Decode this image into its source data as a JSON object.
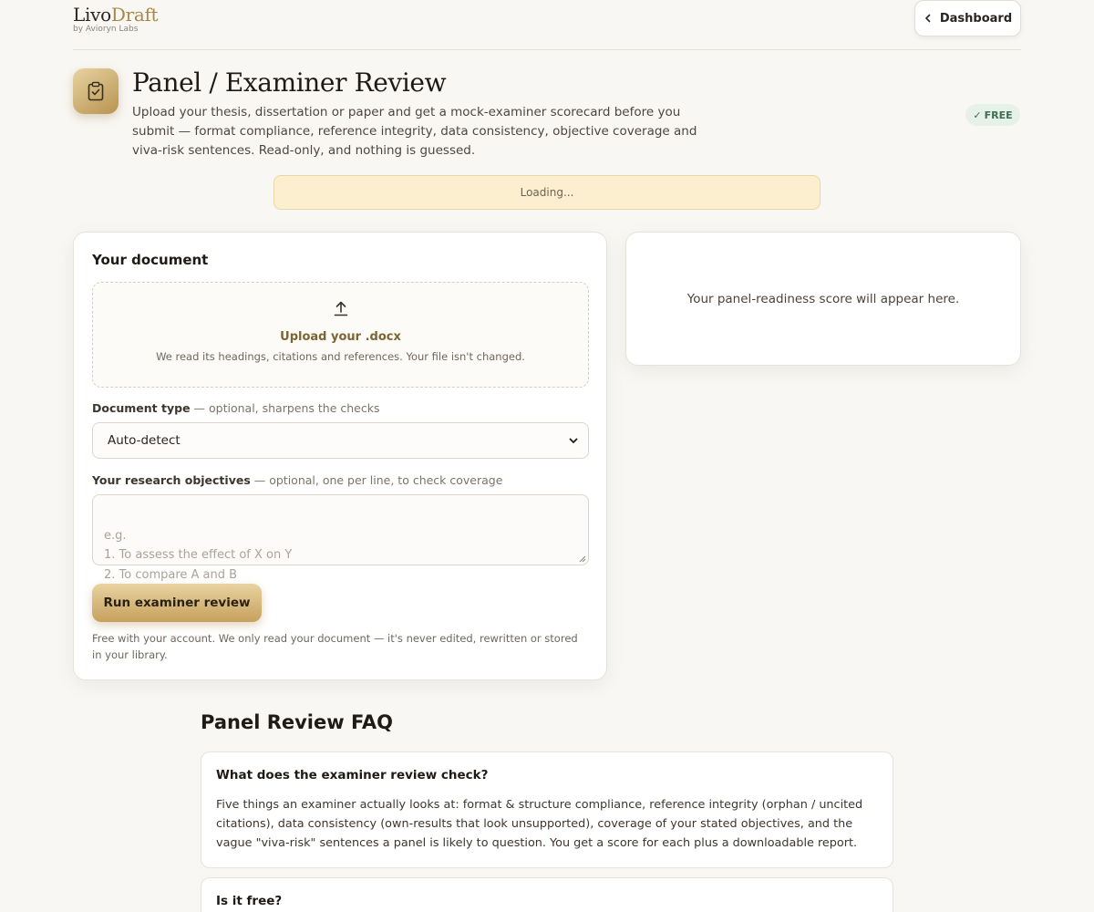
{
  "brand": {
    "name_part1": "Livo",
    "name_part2": "Draft",
    "subtitle": "by Avioryn Labs"
  },
  "nav": {
    "dashboard_label": "Dashboard"
  },
  "header": {
    "title": "Panel / Examiner Review",
    "description": "Upload your thesis, dissertation or paper and get a mock-examiner scorecard before you submit — format compliance, reference integrity, data consistency, objective coverage and viva-risk sentences. Read-only, and nothing is guessed.",
    "badge": "FREE",
    "badge_check": "✓"
  },
  "status": {
    "loading_text": "Loading..."
  },
  "document_card": {
    "heading": "Your document",
    "upload": {
      "title": "Upload your .docx",
      "subtitle": "We read its headings, citations and references. Your file isn't changed."
    },
    "doc_type": {
      "label": "Document type",
      "hint": " — optional, sharpens the checks",
      "selected": "Auto-detect"
    },
    "objectives": {
      "label": "Your research objectives",
      "hint": " — optional, one per line, to check coverage",
      "placeholder": "e.g.\n1. To assess the effect of X on Y\n2. To compare A and B"
    },
    "run_button": "Run examiner review",
    "footnote": "Free with your account. We only read your document — it's never edited, rewritten or stored in your library."
  },
  "result_card": {
    "placeholder": "Your panel-readiness score will appear here."
  },
  "faq": {
    "title": "Panel Review FAQ",
    "items": [
      {
        "question": "What does the examiner review check?",
        "answer": "Five things an examiner actually looks at: format & structure compliance, reference integrity (orphan / uncited citations), data consistency (own-results that look unsupported), coverage of your stated objectives, and the vague \"viva-risk\" sentences a panel is likely to question. You get a score for each plus a downloadable report."
      },
      {
        "question": "Is it free?",
        "answer": ""
      }
    ]
  },
  "icons": {
    "back": "chevron-left-icon",
    "header": "clipboard-check-icon",
    "upload": "upload-arrow-icon",
    "select": "chevron-down-icon"
  },
  "colors": {
    "background": "#f9f7f3",
    "accent_gold": "#c6a15e",
    "brand_accent": "#a8884a",
    "loading_bg": "#fbefcf",
    "badge_bg": "#e6f1e9",
    "badge_text": "#3e6e50"
  }
}
